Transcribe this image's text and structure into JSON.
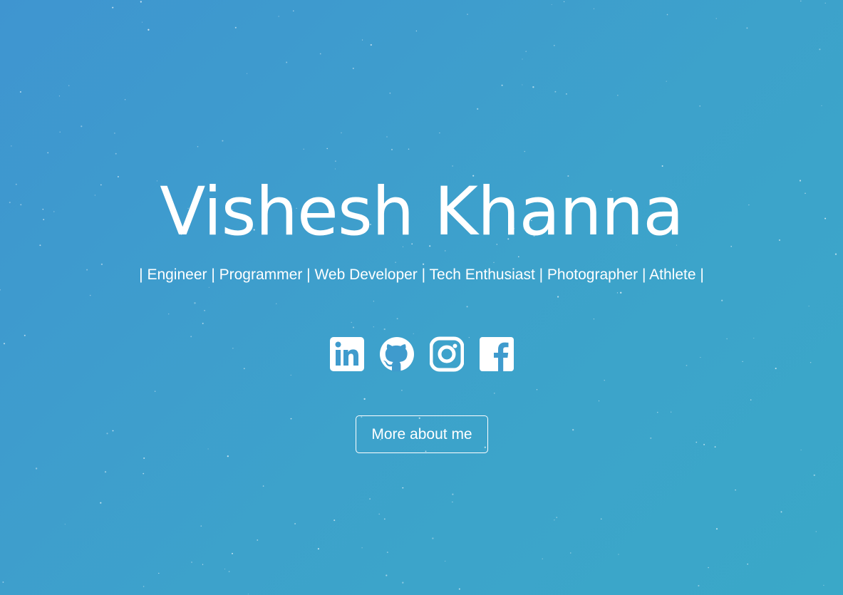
{
  "hero": {
    "name": "Vishesh Khanna",
    "tagline": "| Engineer | Programmer | Web Developer | Tech Enthusiast | Photographer | Athlete |",
    "social": [
      {
        "icon": "linkedin-icon"
      },
      {
        "icon": "github-icon"
      },
      {
        "icon": "instagram-icon"
      },
      {
        "icon": "facebook-icon"
      }
    ],
    "button_label": "More about me"
  },
  "colors": {
    "background_start": "#3f95d0",
    "background_end": "#3aa8c8",
    "text": "#ffffff"
  }
}
